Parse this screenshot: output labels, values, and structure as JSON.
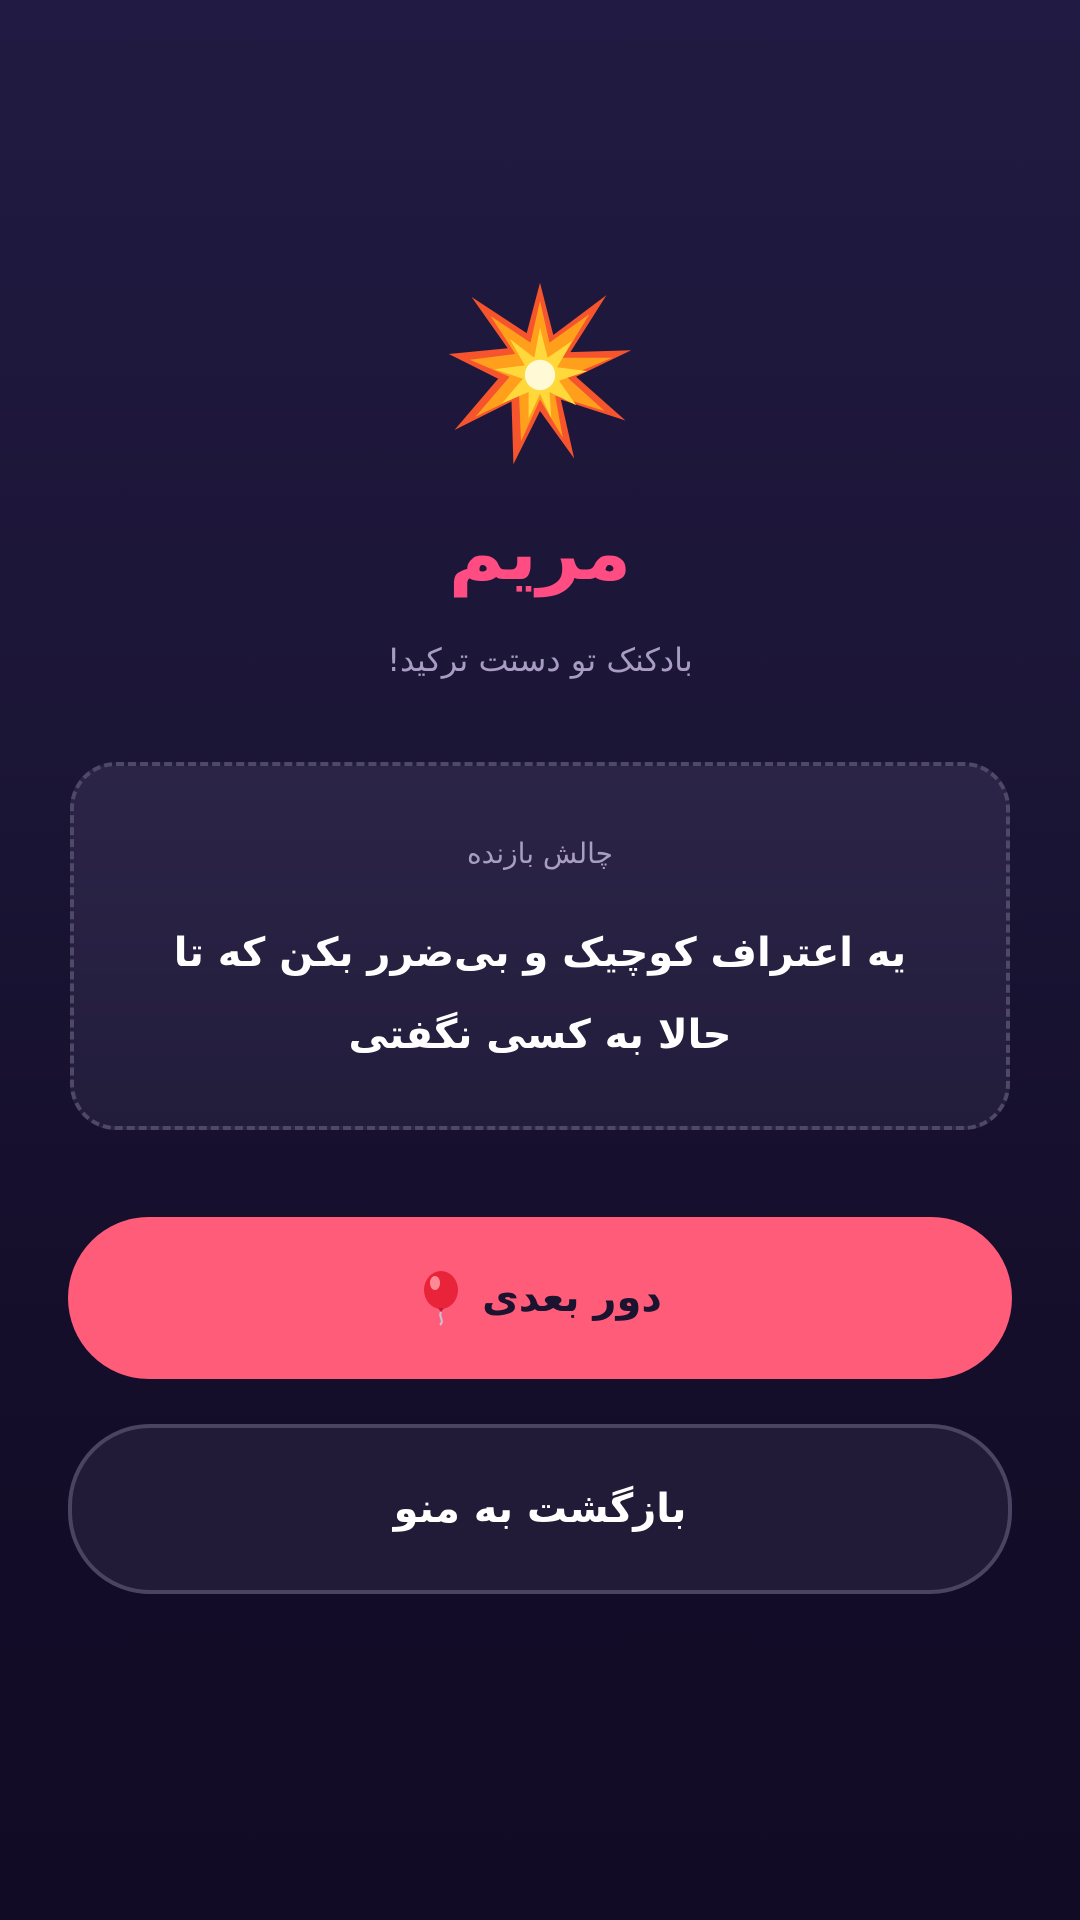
{
  "result": {
    "icon": "collision-burst-icon",
    "player_name": "مریم",
    "message": "بادکنک تو دستت ترکید!"
  },
  "challenge": {
    "label": "چالش بازنده",
    "text": "یه اعتراف کوچیک و بی‌ضرر بکن که تا حالا به کسی نگفتی"
  },
  "actions": {
    "next_round_label": "دور بعدی",
    "next_round_icon": "balloon-icon",
    "back_to_menu_label": "بازگشت به منو"
  },
  "colors": {
    "background": "#1a1434",
    "accent": "#ff5c7a",
    "name": "#ff4d83",
    "muted_text": "#a89cc4"
  }
}
